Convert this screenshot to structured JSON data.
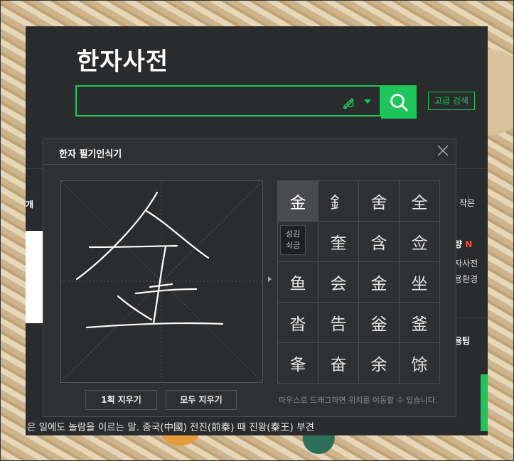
{
  "page_title": "한자사전",
  "search": {
    "placeholder": "",
    "value": "",
    "advanced_label": "고급 검색"
  },
  "background_page": {
    "left_tab_fragment": "개",
    "right_tab_fragment": "작은",
    "right_items": [
      "량 N",
      "자사전",
      "용환경"
    ],
    "right_tip": "용팁",
    "bottom_sentence": "은 일에도 놀람을 이르는 말. 중국(中國) 전진(前秦) 때 진왕(秦王) 부견"
  },
  "handwriting": {
    "title": "한자 필기인식기",
    "candidates": [
      "金",
      "釒",
      "舍",
      "全",
      "奎",
      "含",
      "佥",
      "鱼",
      "会",
      "金",
      "坐",
      "沓",
      "告",
      "釡",
      "釜",
      "夆",
      "奋",
      "余",
      "馀"
    ],
    "candidates_display": [
      "金",
      "釒",
      "舍",
      "全",
      "",
      "奎",
      "含",
      "佥",
      "鱼",
      "会",
      "金",
      "坐",
      "沓",
      "告",
      "釡",
      "釜",
      "夆",
      "奋",
      "余",
      "馀"
    ],
    "tooltip": {
      "line1": "성김",
      "line2": "쇠금"
    },
    "clear_stroke_label": "1획 지우기",
    "clear_all_label": "모두 지우기",
    "hint": "마우스로 드래그하면 위치를 이동할 수 있습니다."
  },
  "colors": {
    "accent": "#1ec55a",
    "panel": "#2a2b2d",
    "popup": "#2f3032",
    "red_badge": "#ff4a3d"
  }
}
